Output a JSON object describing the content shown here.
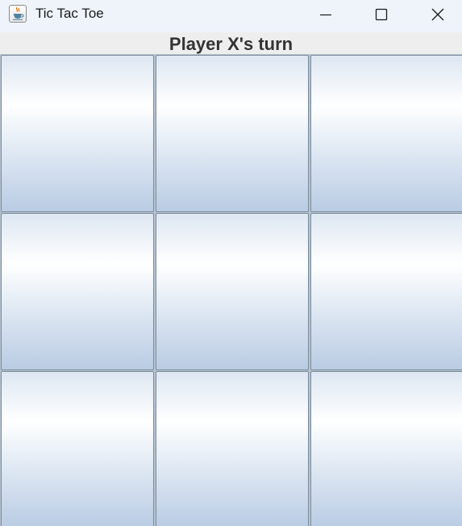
{
  "window": {
    "title": "Tic Tac Toe",
    "icon": "java-cup-icon",
    "controls": [
      "minimize-icon",
      "maximize-icon",
      "close-icon"
    ]
  },
  "status": {
    "text": "Player X's turn"
  },
  "board": {
    "cells": [
      [
        "",
        "",
        ""
      ],
      [
        "",
        "",
        ""
      ],
      [
        "",
        "",
        ""
      ]
    ]
  },
  "colors": {
    "titlebar": "#eef4fa",
    "panel": "#eeeeee",
    "cell_top": "#ffffff",
    "cell_bottom": "#b9cce3",
    "cell_border": "#7a8a99",
    "status_text": "#333333"
  }
}
